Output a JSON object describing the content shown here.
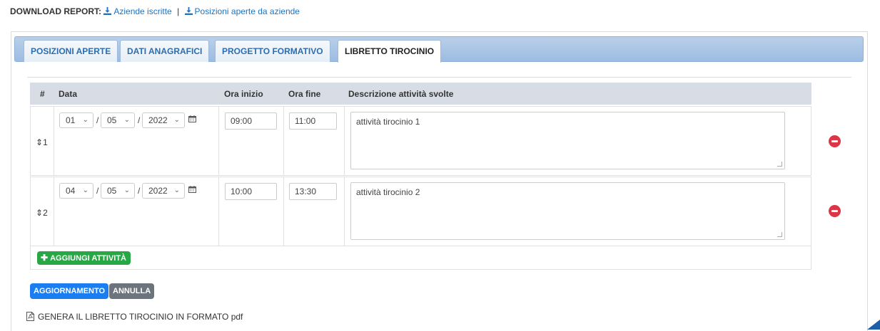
{
  "download": {
    "label": "DOWNLOAD REPORT:",
    "link1": "Aziende iscritte",
    "separator": "|",
    "link2": "Posizioni aperte da aziende"
  },
  "tabs": [
    {
      "label": "POSIZIONI APERTE"
    },
    {
      "label": "DATI ANAGRAFICI"
    },
    {
      "label": "PROGETTO FORMATIVO"
    },
    {
      "label": "LIBRETTO TIROCINIO"
    }
  ],
  "table": {
    "headers": {
      "num": "#",
      "data": "Data",
      "ora_inizio": "Ora inizio",
      "ora_fine": "Ora fine",
      "descrizione": "Descrizione attività svolte"
    },
    "rows": [
      {
        "num": "1",
        "day": "01",
        "month": "05",
        "year": "2022",
        "start": "09:00",
        "end": "11:00",
        "desc": "attività tirocinio 1"
      },
      {
        "num": "2",
        "day": "04",
        "month": "05",
        "year": "2022",
        "start": "10:00",
        "end": "13:30",
        "desc": "attività tirocinio 2"
      }
    ],
    "date_sep": "/",
    "sort_glyph": "⇕",
    "add_label": "AGGIUNGI ATTIVITÀ"
  },
  "buttons": {
    "update": "AGGIORNAMENTO",
    "cancel": "ANNULLA"
  },
  "pdf_link": "GENERA IL LIBRETTO TIROCINIO IN FORMATO pdf",
  "colors": {
    "link": "#1e73be",
    "tab_bar": "#9cbce2",
    "add_button": "#28a745",
    "update_button": "#1a7ef2",
    "cancel_button": "#6c757d",
    "delete": "#dc3545"
  },
  "icons": {
    "download": "download-icon",
    "calendar": "calendar-icon",
    "remove": "minus-circle-icon",
    "pdf": "file-pdf-icon",
    "plus": "plus-icon"
  }
}
